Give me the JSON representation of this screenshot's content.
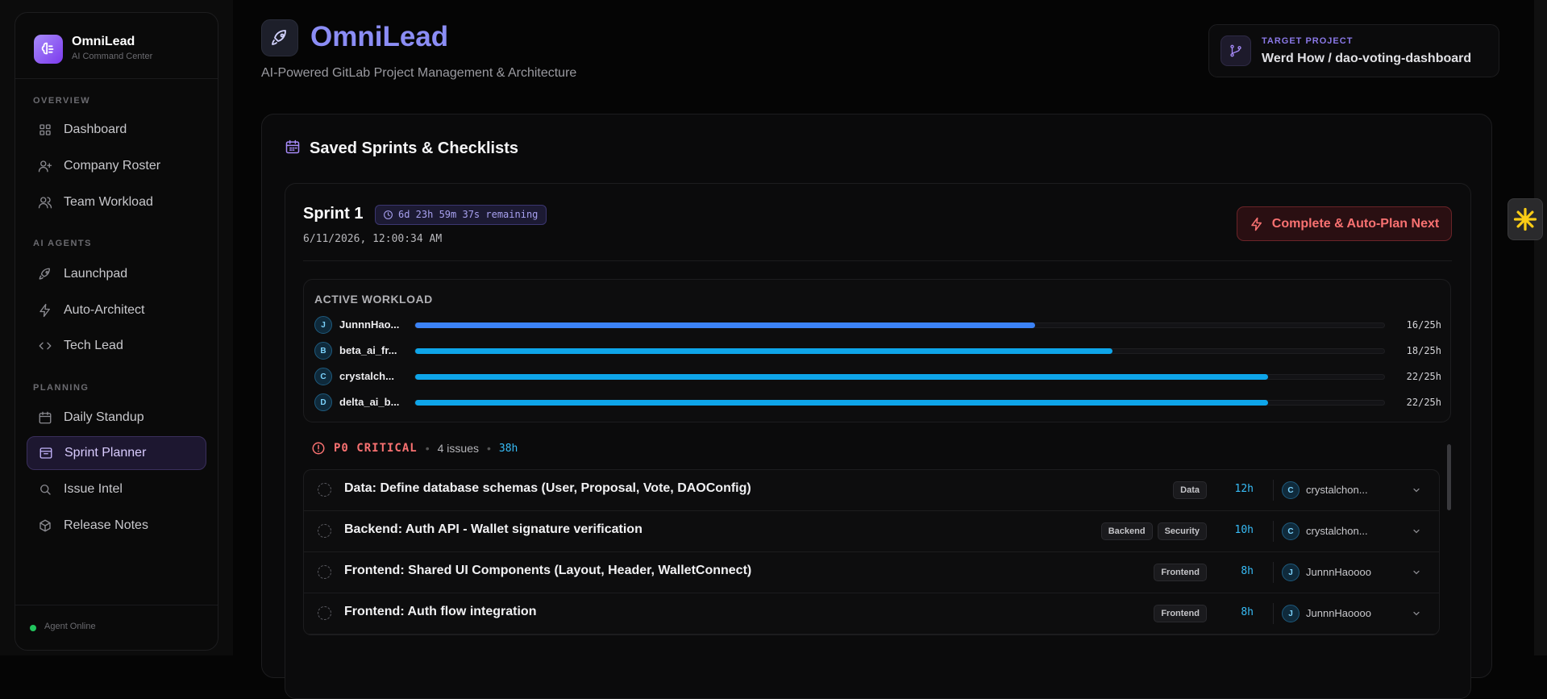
{
  "brand": {
    "name": "OmniLead",
    "subtitle": "AI Command Center"
  },
  "sidebar": {
    "sections": [
      {
        "label": "OVERVIEW"
      },
      {
        "label": "AI AGENTS"
      },
      {
        "label": "PLANNING"
      }
    ],
    "items": [
      {
        "label": "Dashboard",
        "icon": "grid-icon"
      },
      {
        "label": "Company Roster",
        "icon": "user-plus-icon"
      },
      {
        "label": "Team Workload",
        "icon": "users-icon"
      },
      {
        "label": "Launchpad",
        "icon": "rocket-icon"
      },
      {
        "label": "Auto-Architect",
        "icon": "bolt-icon"
      },
      {
        "label": "Tech Lead",
        "icon": "code-icon"
      },
      {
        "label": "Daily Standup",
        "icon": "calendar-icon"
      },
      {
        "label": "Sprint Planner",
        "icon": "archive-icon",
        "active": true
      },
      {
        "label": "Issue Intel",
        "icon": "search-icon"
      },
      {
        "label": "Release Notes",
        "icon": "package-icon"
      }
    ],
    "footer": {
      "status": "Agent Online",
      "status_color": "#22c55e"
    }
  },
  "header": {
    "title": "OmniLead",
    "subtitle": "AI-Powered GitLab Project Management & Architecture",
    "accent": "#8b8df5"
  },
  "project": {
    "label": "TARGET PROJECT",
    "value": "Werd How / dao-voting-dashboard"
  },
  "main": {
    "title": "Saved Sprints & Checklists",
    "sprint": {
      "name": "Sprint 1",
      "remaining": "6d 23h 59m 37s remaining",
      "date": "6/11/2026, 12:00:34 AM",
      "complete_button": "Complete & Auto-Plan Next"
    },
    "workload": {
      "title": "ACTIVE WORKLOAD",
      "members": [
        {
          "initial": "J",
          "name": "JunnnHao...",
          "hours": "16/25h",
          "fraction": 0.64,
          "color": "#3b82f6"
        },
        {
          "initial": "B",
          "name": "beta_ai_fr...",
          "hours": "18/25h",
          "fraction": 0.72,
          "color": "#0ea5e9"
        },
        {
          "initial": "C",
          "name": "crystalch...",
          "hours": "22/25h",
          "fraction": 0.88,
          "color": "#0ea5e9"
        },
        {
          "initial": "D",
          "name": "delta_ai_b...",
          "hours": "22/25h",
          "fraction": 0.88,
          "color": "#0ea5e9"
        }
      ]
    },
    "priority": {
      "label": "P0 CRITICAL",
      "count": "4 issues",
      "hours": "38h",
      "color": "#f87171"
    },
    "issues": [
      {
        "title": "Data: Define database schemas (User, Proposal, Vote, DAOConfig)",
        "tags": [
          "Data"
        ],
        "estimate": "12h",
        "assignee_initial": "C",
        "assignee": "crystalchon..."
      },
      {
        "title": "Backend: Auth API - Wallet signature verification",
        "tags": [
          "Backend",
          "Security"
        ],
        "estimate": "10h",
        "assignee_initial": "C",
        "assignee": "crystalchon..."
      },
      {
        "title": "Frontend: Shared UI Components (Layout, Header, WalletConnect)",
        "tags": [
          "Frontend"
        ],
        "estimate": "8h",
        "assignee_initial": "J",
        "assignee": "JunnnHaoooo"
      },
      {
        "title": "Frontend: Auth flow integration",
        "tags": [
          "Frontend"
        ],
        "estimate": "8h",
        "assignee_initial": "J",
        "assignee": "JunnnHaoooo"
      }
    ]
  }
}
